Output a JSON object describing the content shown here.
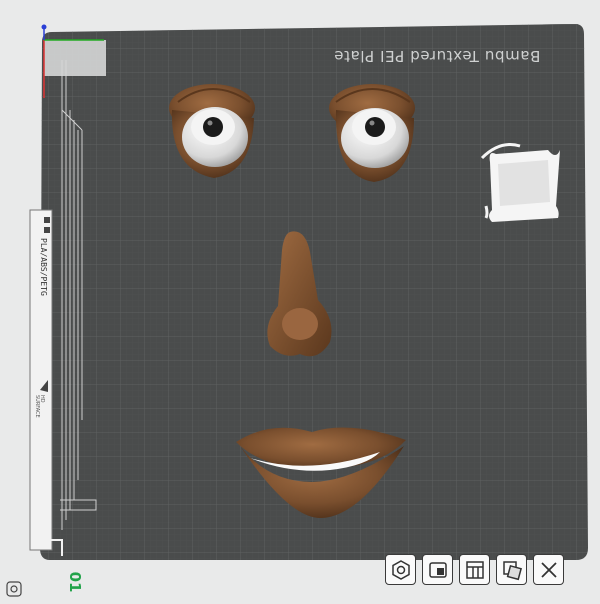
{
  "plate": {
    "label": "Bambu Textured PEI Plate",
    "filament": "PLA/ABS/PETG",
    "surface_note": "HD\nSURFACE",
    "plate_number": "01"
  },
  "objects": [
    {
      "name": "left-eye"
    },
    {
      "name": "right-eye"
    },
    {
      "name": "nose"
    },
    {
      "name": "mouth"
    },
    {
      "name": "square-bracket-part"
    }
  ],
  "toolbar": {
    "buttons": [
      {
        "name": "orient-button",
        "icon": "hexagon-nut-icon"
      },
      {
        "name": "arrange-button",
        "icon": "arrange-icon"
      },
      {
        "name": "layout-button",
        "icon": "layout-icon"
      },
      {
        "name": "auto-orient-button",
        "icon": "rotate-square-icon"
      },
      {
        "name": "close-plate-button",
        "icon": "close-icon"
      }
    ]
  },
  "colors": {
    "bed": "#4a4c4c",
    "grid": "#5d6060",
    "wood": "#7a4f2e",
    "accent_green": "#22a34a"
  }
}
